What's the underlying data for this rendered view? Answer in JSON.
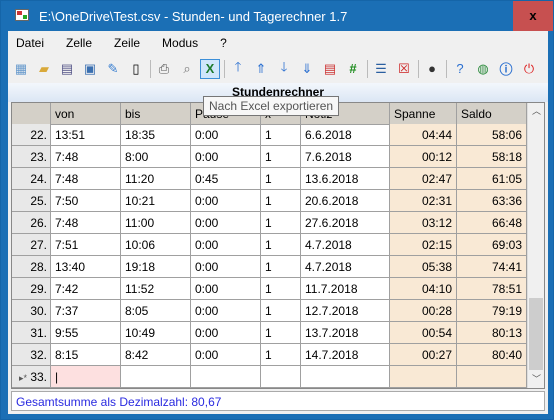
{
  "window": {
    "title": "E:\\OneDrive\\Test.csv - Stunden- und Tagerechner 1.7",
    "close": "x"
  },
  "menu": [
    "Datei",
    "Zelle",
    "Zeile",
    "Modus",
    "?"
  ],
  "toolbar": {
    "icons": [
      "new-table",
      "open-folder",
      "grid",
      "save",
      "edit",
      "export-file",
      "print",
      "print-preview",
      "excel-export",
      "move-up",
      "move-top",
      "move-down",
      "move-bottom",
      "calendar",
      "number",
      "insert-row",
      "delete-row",
      "settings",
      "help",
      "web",
      "info",
      "power"
    ],
    "tooltip": "Nach Excel exportieren"
  },
  "caption": "Stundenrechner",
  "columns": [
    "",
    "von",
    "bis",
    "Pause",
    "x",
    "Notiz",
    "Spanne",
    "Saldo"
  ],
  "rows": [
    [
      "22.",
      "13:51",
      "18:35",
      "0:00",
      "1",
      "6.6.2018",
      "04:44",
      "58:06"
    ],
    [
      "23.",
      "7:48",
      "8:00",
      "0:00",
      "1",
      "7.6.2018",
      "00:12",
      "58:18"
    ],
    [
      "24.",
      "7:48",
      "11:20",
      "0:45",
      "1",
      "13.6.2018",
      "02:47",
      "61:05"
    ],
    [
      "25.",
      "7:50",
      "10:21",
      "0:00",
      "1",
      "20.6.2018",
      "02:31",
      "63:36"
    ],
    [
      "26.",
      "7:48",
      "11:00",
      "0:00",
      "1",
      "27.6.2018",
      "03:12",
      "66:48"
    ],
    [
      "27.",
      "7:51",
      "10:06",
      "0:00",
      "1",
      "4.7.2018",
      "02:15",
      "69:03"
    ],
    [
      "28.",
      "13:40",
      "19:18",
      "0:00",
      "1",
      "4.7.2018",
      "05:38",
      "74:41"
    ],
    [
      "29.",
      "7:42",
      "11:52",
      "0:00",
      "1",
      "11.7.2018",
      "04:10",
      "78:51"
    ],
    [
      "30.",
      "7:37",
      "8:05",
      "0:00",
      "1",
      "12.7.2018",
      "00:28",
      "79:19"
    ],
    [
      "31.",
      "9:55",
      "10:49",
      "0:00",
      "1",
      "13.7.2018",
      "00:54",
      "80:13"
    ],
    [
      "32.",
      "8:15",
      "8:42",
      "0:00",
      "1",
      "14.7.2018",
      "00:27",
      "80:40"
    ]
  ],
  "new_row": {
    "marker": "▸*",
    "label": "33."
  },
  "status": "Gesamtsumme als Dezimalzahl: 80,67"
}
